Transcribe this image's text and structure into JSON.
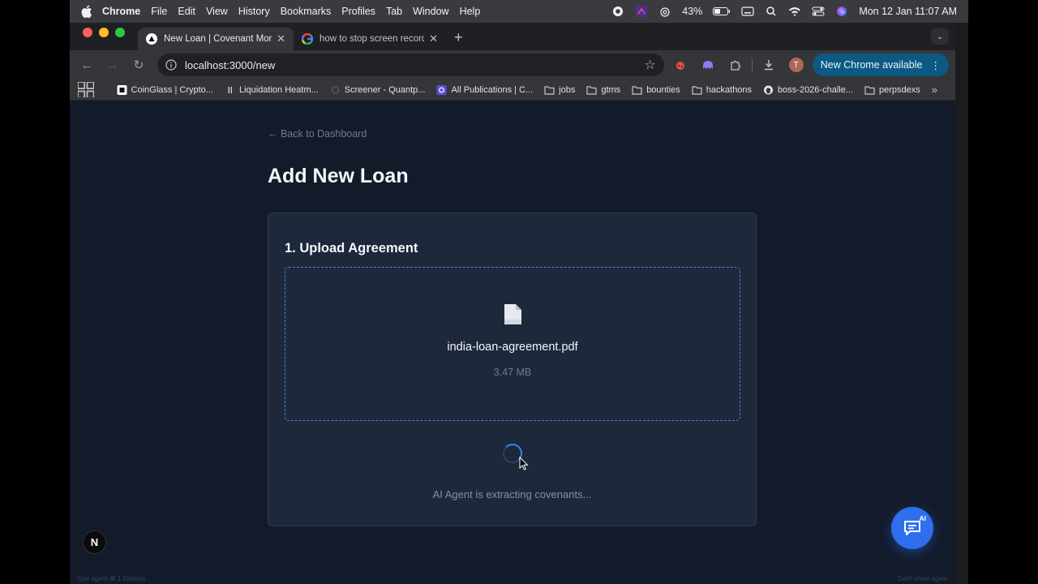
{
  "menubar": {
    "app": "Chrome",
    "items": [
      "File",
      "Edit",
      "View",
      "History",
      "Bookmarks",
      "Profiles",
      "Tab",
      "Window",
      "Help"
    ],
    "battery": "43%",
    "datetime": "Mon 12 Jan  11:07 AM"
  },
  "tabs": [
    {
      "title": "New Loan | Covenant Monitor",
      "active": true
    },
    {
      "title": "how to stop screen record in",
      "active": false
    }
  ],
  "toolbar": {
    "url": "localhost:3000/new",
    "profile_initial": "T",
    "update_label": "New Chrome available"
  },
  "bookmarks": [
    {
      "label": "CoinGlass | Crypto...",
      "icon": "coinglass-icon"
    },
    {
      "label": "Liquidation Heatm...",
      "icon": "heatmap-icon"
    },
    {
      "label": "Screener - Quantp...",
      "icon": "screener-icon"
    },
    {
      "label": "All Publications | C...",
      "icon": "publication-icon"
    },
    {
      "label": "jobs",
      "icon": "folder-icon"
    },
    {
      "label": "gtms",
      "icon": "folder-icon"
    },
    {
      "label": "bounties",
      "icon": "folder-icon"
    },
    {
      "label": "hackathons",
      "icon": "folder-icon"
    },
    {
      "label": "boss-2026-challe...",
      "icon": "github-icon"
    },
    {
      "label": "perpsdexs",
      "icon": "folder-icon"
    }
  ],
  "page": {
    "back_link": "← Back to Dashboard",
    "title": "Add New Loan",
    "section_title": "1. Upload Agreement",
    "file_name": "india-loan-agreement.pdf",
    "file_size": "3.47 MB",
    "status": "AI Agent is extracting covenants...",
    "ai_badge": "AI",
    "next_badge": "N",
    "footer_left": "Use agent  ⌘ 1     Dismiss",
    "footer_right": "Don't show again"
  },
  "colors": {
    "page_bg": "#131b2b",
    "card_bg": "#1d283a",
    "accent": "#3b82f6",
    "fab": "#2f6fed"
  }
}
